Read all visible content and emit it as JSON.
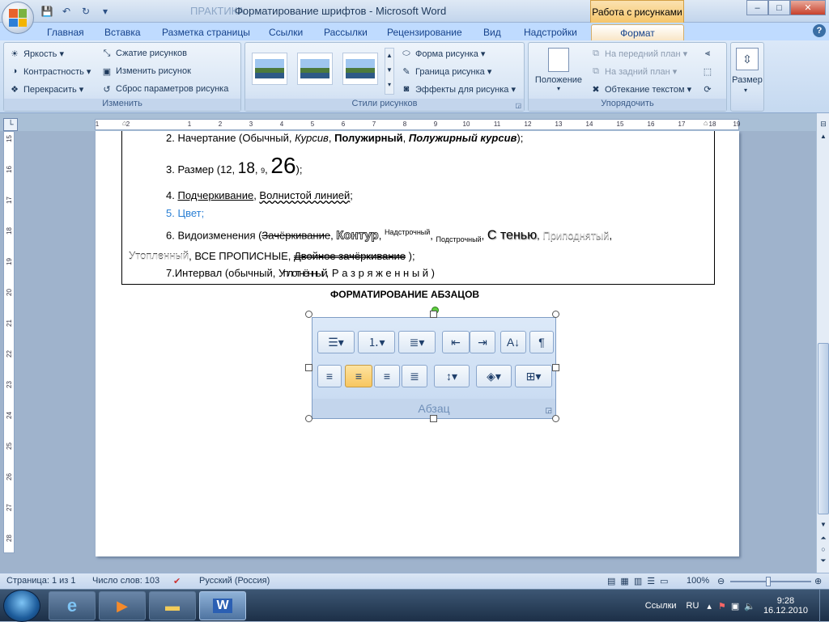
{
  "window": {
    "title": "Форматирование шрифтов - Microsoft Word",
    "ghost_title": "ПРАКТИКА",
    "context_tab": "Работа с рисунками",
    "controls": {
      "minimize": "–",
      "maximize": "□",
      "close": "✕"
    }
  },
  "qat": {
    "save": "💾",
    "undo": "↶",
    "redo": "↻",
    "customize": "▾"
  },
  "tabs": [
    "Главная",
    "Вставка",
    "Разметка страницы",
    "Ссылки",
    "Рассылки",
    "Рецензирование",
    "Вид",
    "Надстройки",
    "Формат"
  ],
  "active_tab": "Формат",
  "ribbon": {
    "izmenit": {
      "label": "Изменить",
      "items": [
        "Яркость ▾",
        "Контрастность ▾",
        "Перекрасить ▾",
        "Сжатие рисунков",
        "Изменить рисунок",
        "Сброс параметров рисунка"
      ]
    },
    "styles": {
      "label": "Стили рисунков",
      "items": [
        "Форма рисунка ▾",
        "Граница рисунка ▾",
        "Эффекты для рисунка ▾"
      ]
    },
    "arrange": {
      "label": "Упорядочить",
      "position": "Положение",
      "items": [
        "На передний план ▾",
        "На задний план ▾",
        "Обтекание текстом ▾"
      ]
    },
    "size": {
      "label": "Размер"
    }
  },
  "ruler": {
    "h": [
      "1",
      "2",
      "1",
      "2",
      "3",
      "4",
      "5",
      "6",
      "7",
      "8",
      "9",
      "10",
      "11",
      "12",
      "13",
      "14",
      "15",
      "16",
      "17",
      "18",
      "19"
    ],
    "v": [
      "15",
      "16",
      "17",
      "18",
      "19",
      "20",
      "21",
      "22",
      "23",
      "24",
      "25",
      "26",
      "27",
      "28"
    ]
  },
  "document": {
    "l2": {
      "a": "2. Начертание (Обычный, ",
      "b": "Курсив",
      ",": ", ",
      "c": "Полужирный",
      "d": "Полужирный курсив",
      "e": ");"
    },
    "l3": {
      "a": "3. Размер (12, ",
      "b": "18",
      ",": ", ",
      "c": "9",
      "d": "26",
      "e": ");"
    },
    "l4": {
      "a": "4. ",
      "b": "Подчеркивание",
      "c": ", ",
      "d": "Волнистой линией",
      "e": ";"
    },
    "l5": "5. Цвет;",
    "l6": {
      "a": "6. Видоизменения (",
      "b": "Зачёркивание",
      "c": ", ",
      "d": "Контур",
      "e": ", ",
      "f": "Надстрочный",
      "g": ", ",
      "h": "Подстрочный",
      "i": ", ",
      "j": "С тенью",
      "k": ", ",
      "l": "Приподнятый",
      "m": ","
    },
    "l7": {
      "a": "Утопленный",
      "b": ", ВСЕ ПРОПИСНЫЕ, ",
      "c": "Двойное зачёркивание",
      "d": " );"
    },
    "l8": {
      "a": "7.Интервал (обычный, ",
      "b": "Уплотнённый",
      "c": ", ",
      "d": "Р а з р я ж е н н ы й )"
    },
    "heading": "ФОРМАТИРОВАНИЕ АБЗАЦОВ",
    "para_label": "Абзац"
  },
  "status": {
    "page": "Страница: 1 из 1",
    "words": "Число слов: 103",
    "lang": "Русский (Россия)",
    "zoom": "100%"
  },
  "taskbar": {
    "lang": "RU",
    "links": "Ссылки",
    "time": "9:28",
    "date": "16.12.2010"
  }
}
